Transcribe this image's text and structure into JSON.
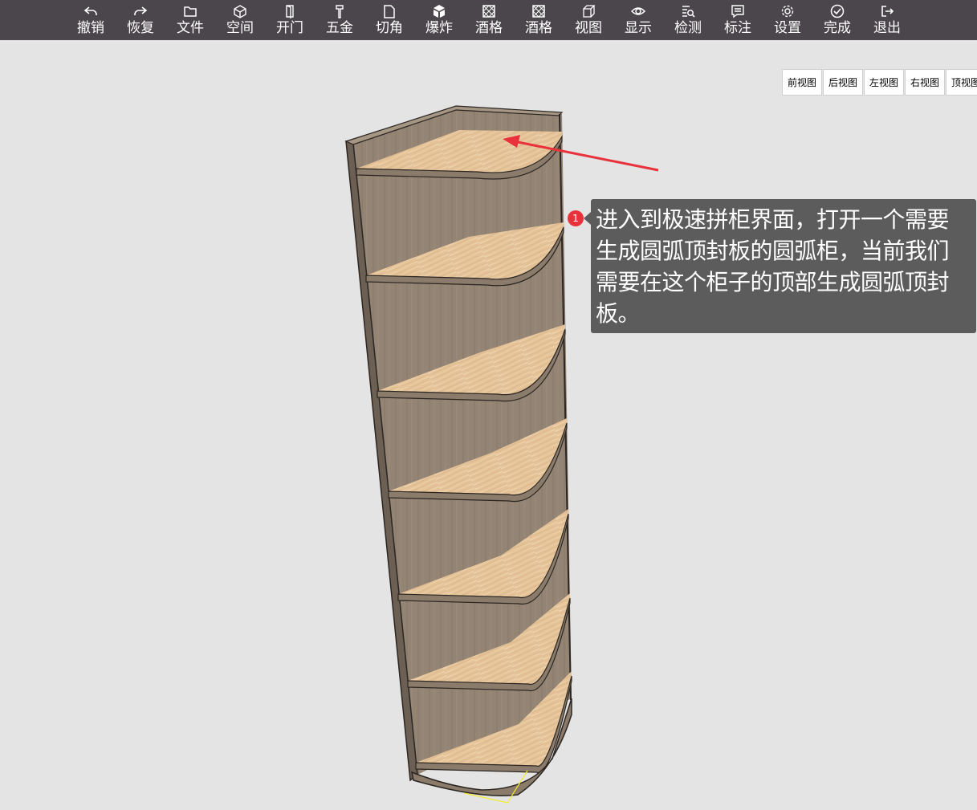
{
  "toolbar": {
    "items": [
      {
        "label": "撤销",
        "icon": "undo-icon"
      },
      {
        "label": "恢复",
        "icon": "redo-icon"
      },
      {
        "label": "文件",
        "icon": "folder-icon"
      },
      {
        "label": "空间",
        "icon": "cube-icon"
      },
      {
        "label": "开门",
        "icon": "door-icon"
      },
      {
        "label": "五金",
        "icon": "hardware-icon"
      },
      {
        "label": "切角",
        "icon": "cut-corner-icon"
      },
      {
        "label": "爆炸",
        "icon": "explode-icon"
      },
      {
        "label": "酒格",
        "icon": "wine-grid-icon"
      },
      {
        "label": "酒格",
        "icon": "wine-grid-icon"
      },
      {
        "label": "视图",
        "icon": "view-cube-icon"
      },
      {
        "label": "显示",
        "icon": "eye-icon"
      },
      {
        "label": "检测",
        "icon": "inspect-icon"
      },
      {
        "label": "标注",
        "icon": "annotation-icon"
      },
      {
        "label": "设置",
        "icon": "gear-icon"
      },
      {
        "label": "完成",
        "icon": "check-circle-icon"
      },
      {
        "label": "退出",
        "icon": "exit-icon"
      }
    ]
  },
  "view_buttons": [
    "前视图",
    "后视图",
    "左视图",
    "右视图",
    "顶视图"
  ],
  "tutorial": {
    "step": "1",
    "lines": [
      "进入到极速拼柜界面，打开一个需要",
      "生成圆弧顶封板的圆弧柜，当前我们",
      "需要在这个柜子的顶部生成圆弧顶封",
      "板。"
    ]
  },
  "colors": {
    "toolbar_bg": "#4b464b",
    "canvas_bg": "#e4e4e4",
    "callout_bg": "#5c5c5c",
    "arrow": "#e8313a",
    "shelf_wood": "#e8c9a0",
    "cabinet_body": "#8a7b6a"
  }
}
